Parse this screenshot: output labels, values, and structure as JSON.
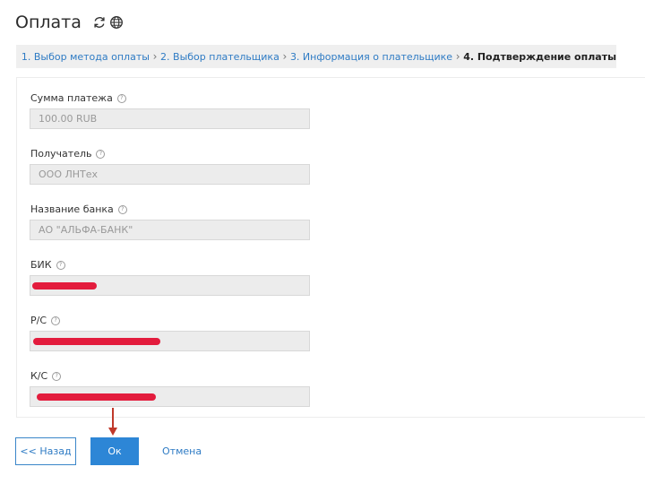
{
  "page": {
    "title": "Оплата"
  },
  "header_icons": [
    "refresh-icon",
    "globe-icon"
  ],
  "steps": [
    {
      "label": "1. Выбор метода оплаты"
    },
    {
      "label": "2. Выбор плательщика"
    },
    {
      "label": "3. Информация о плательщике"
    },
    {
      "label": "4. Подтверждение оплаты",
      "active": true
    }
  ],
  "form": {
    "help_symbol": "?",
    "fields": [
      {
        "label": "Сумма платежа",
        "value": "100.00 RUB"
      },
      {
        "label": "Получатель",
        "value": "ООО ЛНТех"
      },
      {
        "label": "Название банка",
        "value": "АО \"АЛЬФА-БАНК\""
      },
      {
        "label": "БИК",
        "value": ""
      },
      {
        "label": "Р/С",
        "value": ""
      },
      {
        "label": "К/С",
        "value": ""
      }
    ]
  },
  "buttons": {
    "back": "<< Назад",
    "ok": "Ок",
    "cancel": "Отмена"
  },
  "colors": {
    "accent": "#2d86d6",
    "link": "#2e7bc4",
    "redaction": "#e31c3d",
    "annotation_arrow": "#c0392b"
  }
}
